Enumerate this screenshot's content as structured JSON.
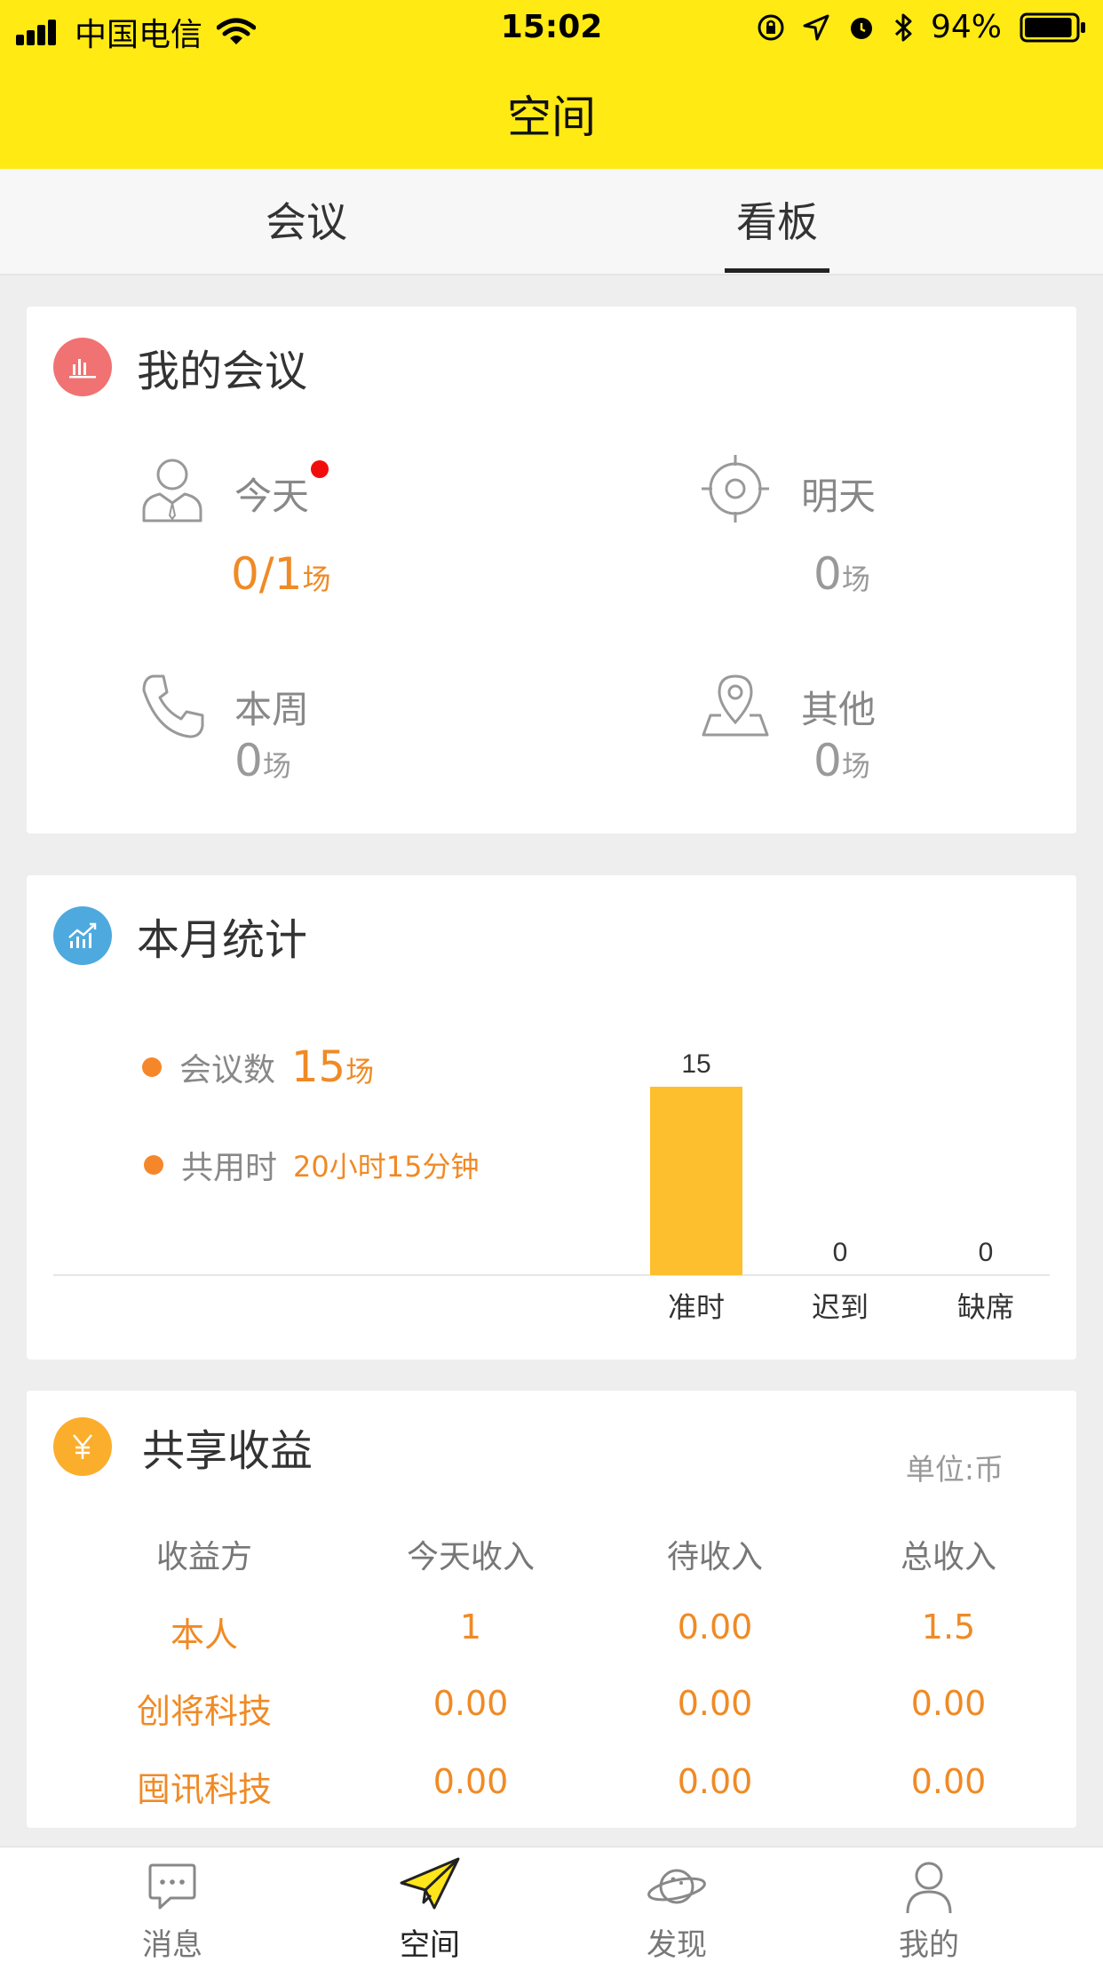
{
  "status_bar": {
    "carrier": "中国电信",
    "time": "15:02",
    "battery": "94%",
    "battery_level": 0.94,
    "icons": [
      "signal-icon",
      "wifi-icon",
      "orientation-lock-icon",
      "location-arrow-icon",
      "alarm-icon",
      "bluetooth-icon",
      "battery-icon"
    ]
  },
  "nav": {
    "title": "空间"
  },
  "tabs": [
    {
      "label": "会议",
      "active": false
    },
    {
      "label": "看板",
      "active": true
    }
  ],
  "my_meetings": {
    "title": "我的会议",
    "icon": "bar-chart-icon",
    "icon_color": "#f07070",
    "items": [
      {
        "label": "今天",
        "value": "0/1",
        "unit": "场",
        "icon": "person-icon",
        "has_dot": true
      },
      {
        "label": "明天",
        "value": "0",
        "unit": "场",
        "icon": "target-icon"
      },
      {
        "label": "本周",
        "value": "0",
        "unit": "场",
        "icon": "phone-icon"
      },
      {
        "label": "其他",
        "value": "0",
        "unit": "场",
        "icon": "location-pin-icon"
      }
    ]
  },
  "monthly_stats": {
    "title": "本月统计",
    "icon": "trend-chart-icon",
    "icon_color": "#4aa8e0",
    "meeting_count_label": "会议数",
    "meeting_count_value": "15",
    "meeting_count_unit": "场",
    "total_time_label": "共用时",
    "total_time_value": "20小时15分钟"
  },
  "chart_data": {
    "type": "bar",
    "categories": [
      "准时",
      "迟到",
      "缺席"
    ],
    "values": [
      15,
      0,
      0
    ],
    "data_labels": [
      "15",
      "0",
      "0"
    ],
    "bar_color": "#fdbf2d"
  },
  "shared_income": {
    "title": "共享收益",
    "icon": "yen-icon",
    "icon_color": "#fbae2c",
    "unit_note": "单位:币",
    "headers": [
      "收益方",
      "今天收入",
      "待收入",
      "总收入"
    ],
    "rows": [
      [
        "本人",
        "1",
        "0.00",
        "1.5"
      ],
      [
        "创将科技",
        "0.00",
        "0.00",
        "0.00"
      ],
      [
        "囤讯科技",
        "0.00",
        "0.00",
        "0.00"
      ]
    ]
  },
  "tabbar": [
    {
      "label": "消息",
      "icon": "message-icon",
      "active": false
    },
    {
      "label": "空间",
      "icon": "paper-plane-icon",
      "active": true
    },
    {
      "label": "发现",
      "icon": "planet-icon",
      "active": false
    },
    {
      "label": "我的",
      "icon": "user-icon",
      "active": false
    }
  ]
}
